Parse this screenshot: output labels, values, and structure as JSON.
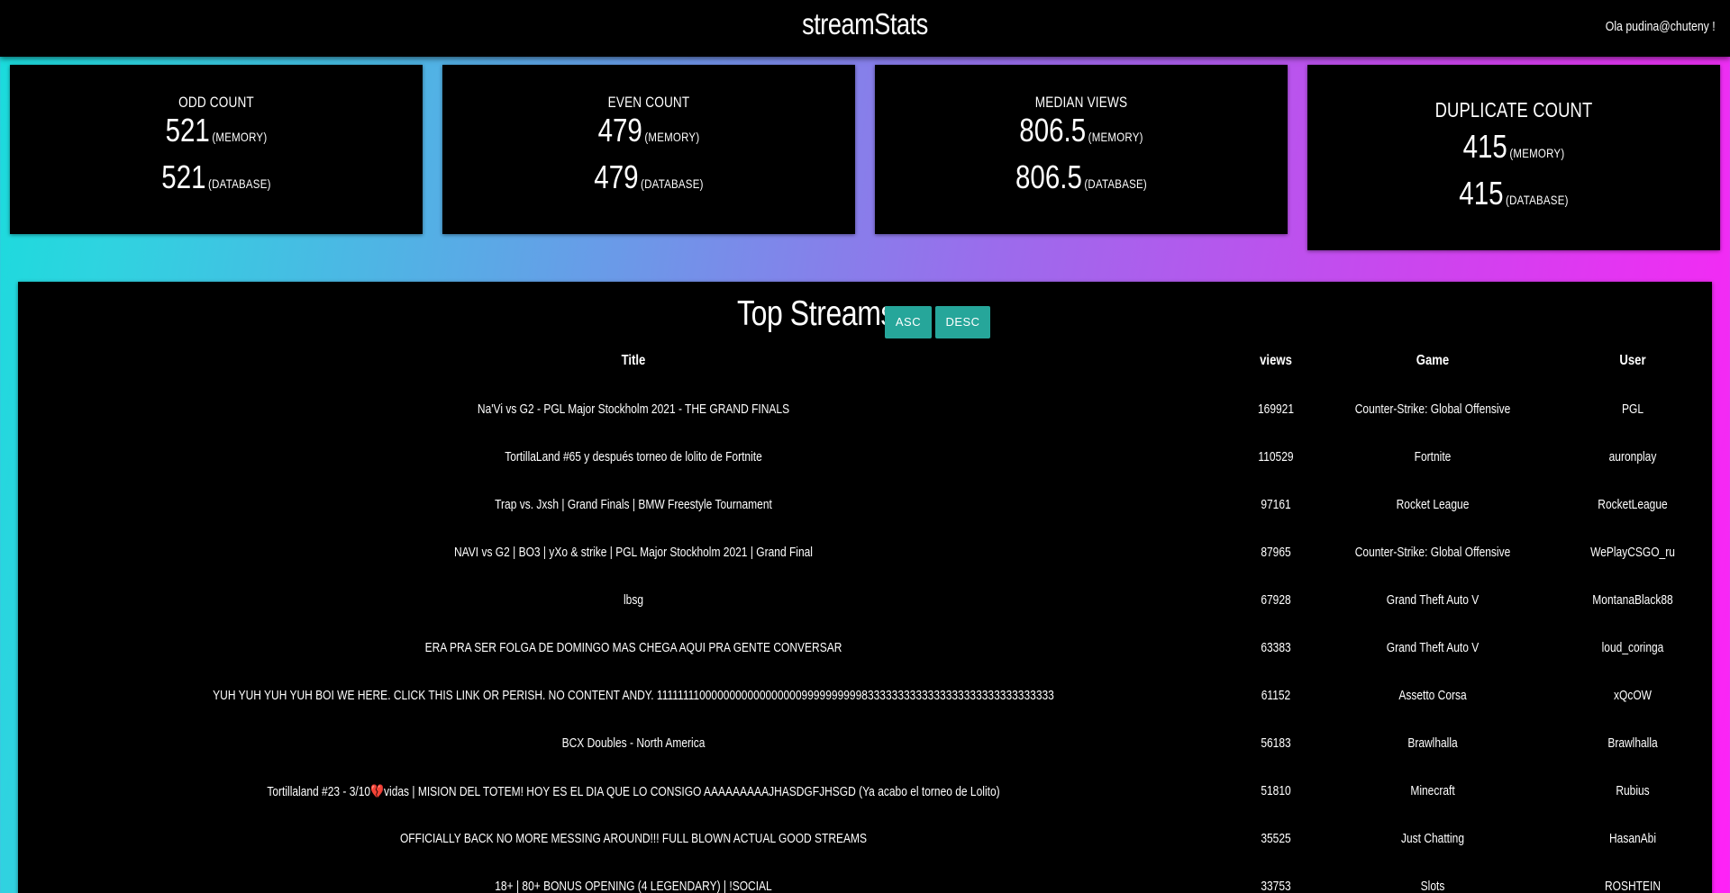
{
  "header": {
    "app_title": "streamStats",
    "user_greeting": "Ola pudina@chuteny !"
  },
  "stats": [
    {
      "label": "ODD COUNT",
      "memory_value": "521",
      "memory_label": "(MEMORY)",
      "database_value": "521",
      "database_label": "(DATABASE)"
    },
    {
      "label": "EVEN COUNT",
      "memory_value": "479",
      "memory_label": "(MEMORY)",
      "database_value": "479",
      "database_label": "(DATABASE)"
    },
    {
      "label": "MEDIAN VIEWS",
      "memory_value": "806.5",
      "memory_label": "(MEMORY)",
      "database_value": "806.5",
      "database_label": "(DATABASE)"
    },
    {
      "label": "DUPLICATE COUNT",
      "memory_value": "415",
      "memory_label": "(MEMORY)",
      "database_value": "415",
      "database_label": "(DATABASE)"
    }
  ],
  "top_streams": {
    "title": "Top Streams",
    "asc_label": "ASC",
    "desc_label": "DESC",
    "columns": [
      "Title",
      "views",
      "Game",
      "User"
    ],
    "rows": [
      {
        "title": "Na'Vi vs G2 - PGL Major Stockholm 2021 - THE GRAND FINALS",
        "views": "169921",
        "game": "Counter-Strike: Global Offensive",
        "user": "PGL"
      },
      {
        "title": "TortillaLand #65 y después torneo de lolito de Fortnite",
        "views": "110529",
        "game": "Fortnite",
        "user": "auronplay"
      },
      {
        "title": "Trap vs. Jxsh | Grand Finals | BMW Freestyle Tournament",
        "views": "97161",
        "game": "Rocket League",
        "user": "RocketLeague"
      },
      {
        "title": "NAVI vs G2 | BO3 | yXo & strike | PGL Major Stockholm 2021 | Grand Final",
        "views": "87965",
        "game": "Counter-Strike: Global Offensive",
        "user": "WePlayCSGO_ru"
      },
      {
        "title": "lbsg",
        "views": "67928",
        "game": "Grand Theft Auto V",
        "user": "MontanaBlack88"
      },
      {
        "title": "ERA PRA SER FOLGA DE DOMINGO MAS CHEGA AQUI PRA GENTE CONVERSAR",
        "views": "63383",
        "game": "Grand Theft Auto V",
        "user": "loud_coringa"
      },
      {
        "title": "YUH YUH YUH YUH BOI WE HERE. CLICK THIS LINK OR PERISH. NO CONTENT ANDY. 1111111100000000000000000999999999983333333333333333333333333333333",
        "views": "61152",
        "game": "Assetto Corsa",
        "user": "xQcOW"
      },
      {
        "title": "BCX Doubles - North America",
        "views": "56183",
        "game": "Brawlhalla",
        "user": "Brawlhalla"
      },
      {
        "title": "Tortillaland #23 - 3/10💔vidas | MISION DEL TOTEM! HOY ES EL DIA QUE LO CONSIGO AAAAAAAAAJHASDGFJHSGD (Ya acabo el torneo de Lolito)",
        "views": "51810",
        "game": "Minecraft",
        "user": "Rubius"
      },
      {
        "title": "OFFICIALLY BACK NO MORE MESSING AROUND!!! FULL BLOWN ACTUAL GOOD STREAMS",
        "views": "35525",
        "game": "Just Chatting",
        "user": "HasanAbi"
      },
      {
        "title": "18+ | 80+ BONUS OPENING (4 LEGENDARY) | !SOCIAL",
        "views": "33753",
        "game": "Slots",
        "user": "ROSHTEIN"
      }
    ]
  }
}
